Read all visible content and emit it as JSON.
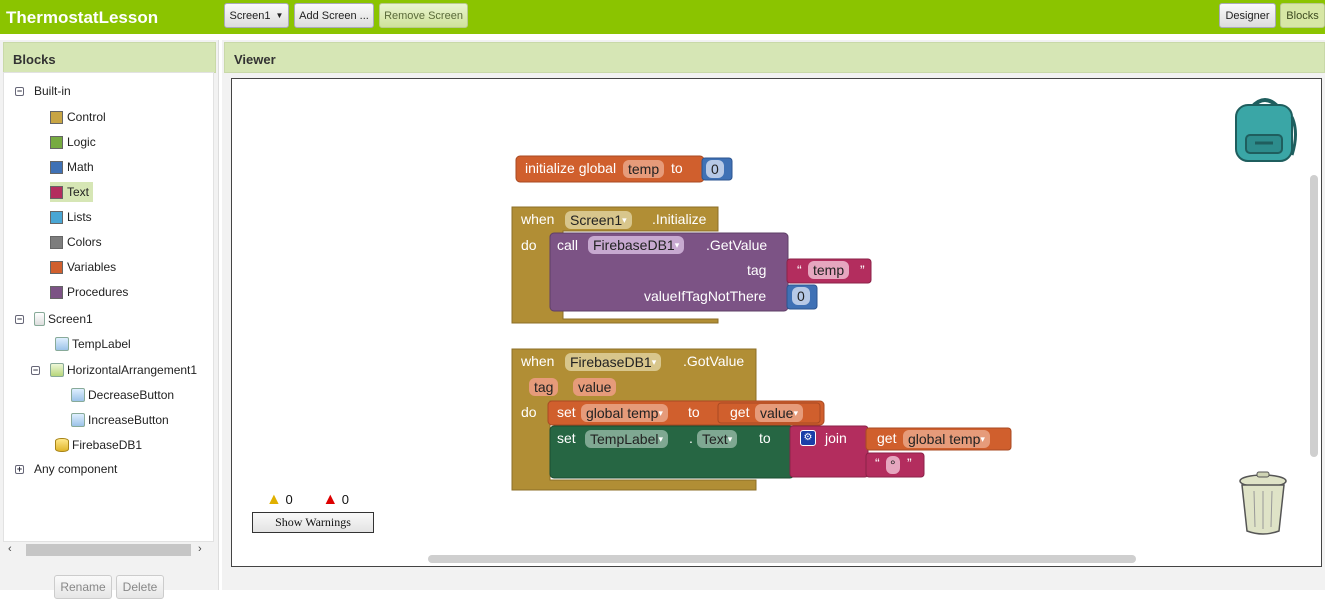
{
  "app": {
    "title": "ThermostatLesson"
  },
  "toolbar": {
    "screen_select": "Screen1",
    "add_screen": "Add Screen ...",
    "remove_screen": "Remove Screen",
    "designer": "Designer",
    "blocks": "Blocks"
  },
  "blocks_panel": {
    "title": "Blocks",
    "builtin_label": "Built-in",
    "builtin": [
      {
        "label": "Control",
        "color": "#c8a544"
      },
      {
        "label": "Logic",
        "color": "#77ab41"
      },
      {
        "label": "Math",
        "color": "#3f71b5"
      },
      {
        "label": "Text",
        "color": "#b32d5e"
      },
      {
        "label": "Lists",
        "color": "#49a6d4"
      },
      {
        "label": "Colors",
        "color": "#7d7d7d"
      },
      {
        "label": "Variables",
        "color": "#d05f2d"
      },
      {
        "label": "Procedures",
        "color": "#7c5385"
      }
    ],
    "components": {
      "screen": "Screen1",
      "temp_label": "TempLabel",
      "arrangement": "HorizontalArrangement1",
      "decrease": "DecreaseButton",
      "increase": "IncreaseButton",
      "firebase": "FirebaseDB1"
    },
    "any_component": "Any component",
    "rename": "Rename",
    "delete": "Delete"
  },
  "viewer": {
    "title": "Viewer",
    "warnings_count": "0",
    "errors_count": "0",
    "show_warnings": "Show Warnings"
  },
  "blocks": {
    "init": {
      "prefix": "initialize global",
      "name": "temp",
      "to": "to",
      "value": "0"
    },
    "screen_init": {
      "when": "when",
      "component": "Screen1",
      "event": ".Initialize",
      "do": "do",
      "call": "call",
      "db": "FirebaseDB1",
      "method": ".GetValue",
      "tag_label": "tag",
      "q_open": "“",
      "tag_value": "temp",
      "q_close": "”",
      "value_label": "valueIfTagNotThere",
      "value": "0"
    },
    "got_value": {
      "when": "when",
      "component": "FirebaseDB1",
      "event": ".GotValue",
      "param1": "tag",
      "param2": "value",
      "do": "do",
      "set": "set",
      "var": "global temp",
      "to": "to",
      "get": "get",
      "get_var": "value",
      "set2": "set",
      "label": "TempLabel",
      "dot": ".",
      "prop": "Text",
      "to2": "to",
      "join": "join",
      "get2": "get",
      "get2_var": "global temp",
      "deg_open": "“",
      "deg": "°",
      "deg_close": "”"
    }
  },
  "colors": {
    "topbar": "#8bc400",
    "event": "#b18e35",
    "variable": "#d05f2d",
    "math": "#3f71b5",
    "db_method": "#7c5385",
    "text": "#b32d5e",
    "setter": "#266643"
  }
}
